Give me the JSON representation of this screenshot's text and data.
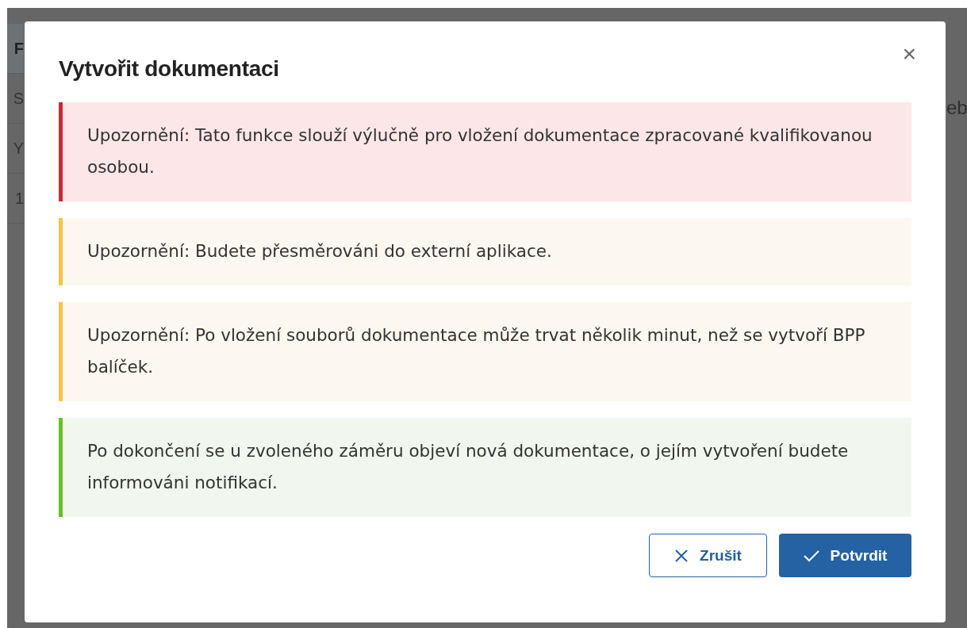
{
  "background_table": {
    "rows": [
      {
        "cell": "F",
        "selected": true
      },
      {
        "cell": "S",
        "selected": false
      },
      {
        "cell": "Y",
        "selected": false
      },
      {
        "cell": "1",
        "selected": false
      }
    ],
    "right_text": "eb"
  },
  "dialog": {
    "title": "Vytvořit dokumentaci",
    "close": "×",
    "alerts": [
      {
        "kind": "danger",
        "text": "Upozornění: Tato funkce slouží výlučně pro vložení dokumentace zpracované kvalifikovanou osobou."
      },
      {
        "kind": "warning",
        "text": "Upozornění: Budete přesměrováni do externí aplikace."
      },
      {
        "kind": "warning",
        "text": "Upozornění: Po vložení souborů dokumentace může trvat několik minut, než se vytvoří BPP balíček."
      },
      {
        "kind": "success",
        "text": "Po dokončení se u zvoleného záměru objeví nová dokumentace, o jejím vytvoření budete informováni notifikací."
      }
    ],
    "buttons": [
      {
        "kind": "cancel",
        "label": "Zrušit"
      },
      {
        "kind": "confirm",
        "label": "Potvrdit"
      }
    ]
  }
}
